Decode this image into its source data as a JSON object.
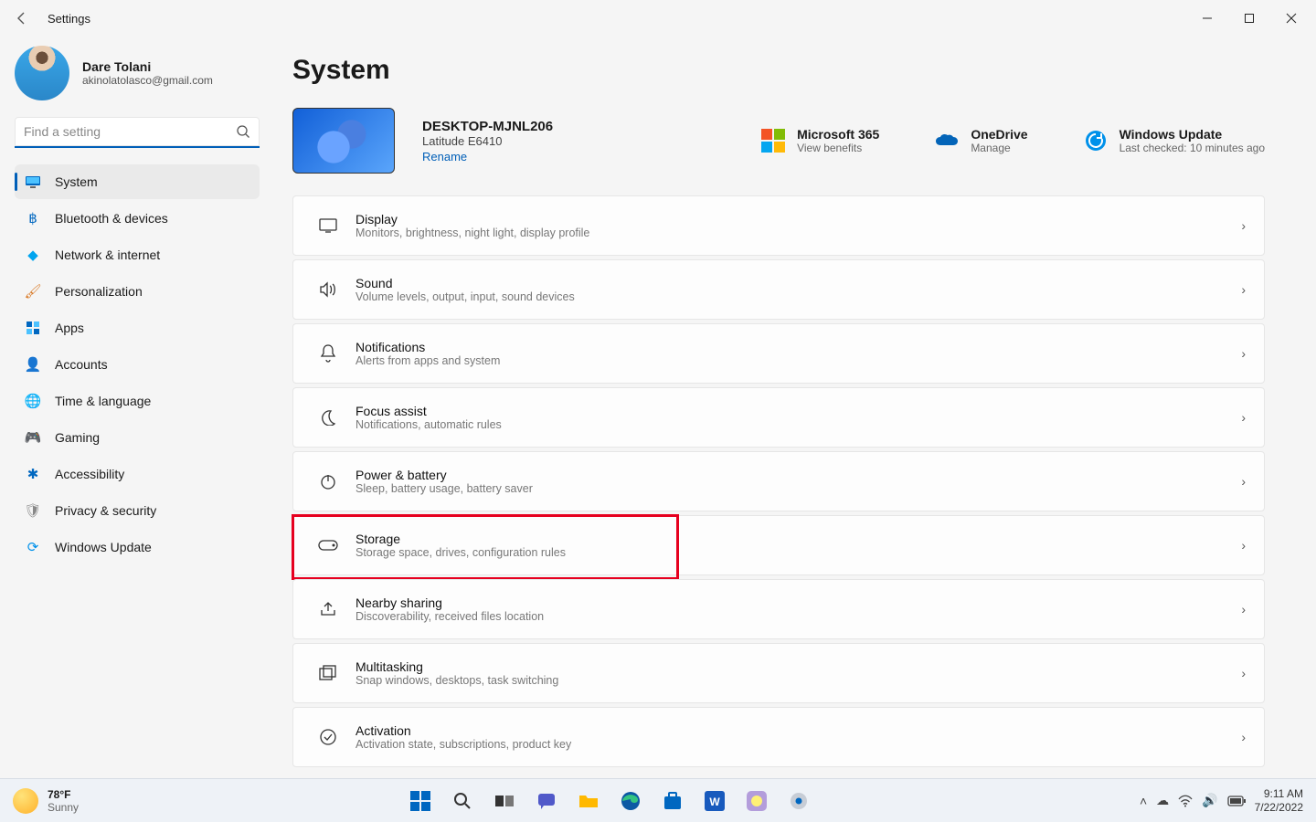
{
  "window": {
    "title": "Settings"
  },
  "user": {
    "name": "Dare Tolani",
    "email": "akinolatolasco@gmail.com"
  },
  "search": {
    "placeholder": "Find a setting"
  },
  "nav": [
    {
      "label": "System",
      "active": true,
      "icon": "monitor"
    },
    {
      "label": "Bluetooth & devices",
      "active": false,
      "icon": "bluetooth"
    },
    {
      "label": "Network & internet",
      "active": false,
      "icon": "wifi-gem"
    },
    {
      "label": "Personalization",
      "active": false,
      "icon": "brush"
    },
    {
      "label": "Apps",
      "active": false,
      "icon": "apps"
    },
    {
      "label": "Accounts",
      "active": false,
      "icon": "person"
    },
    {
      "label": "Time & language",
      "active": false,
      "icon": "globe-clock"
    },
    {
      "label": "Gaming",
      "active": false,
      "icon": "gamepad"
    },
    {
      "label": "Accessibility",
      "active": false,
      "icon": "accessibility"
    },
    {
      "label": "Privacy & security",
      "active": false,
      "icon": "shield"
    },
    {
      "label": "Windows Update",
      "active": false,
      "icon": "update"
    }
  ],
  "page_title": "System",
  "device": {
    "name": "DESKTOP-MJNL206",
    "model": "Latitude E6410",
    "rename": "Rename"
  },
  "services": {
    "ms365": {
      "title": "Microsoft 365",
      "sub": "View benefits"
    },
    "onedrive": {
      "title": "OneDrive",
      "sub": "Manage"
    },
    "update": {
      "title": "Windows Update",
      "sub": "Last checked: 10 minutes ago"
    }
  },
  "cards": {
    "display": {
      "title": "Display",
      "sub": "Monitors, brightness, night light, display profile"
    },
    "sound": {
      "title": "Sound",
      "sub": "Volume levels, output, input, sound devices"
    },
    "notifications": {
      "title": "Notifications",
      "sub": "Alerts from apps and system"
    },
    "focus": {
      "title": "Focus assist",
      "sub": "Notifications, automatic rules"
    },
    "power": {
      "title": "Power & battery",
      "sub": "Sleep, battery usage, battery saver"
    },
    "storage": {
      "title": "Storage",
      "sub": "Storage space, drives, configuration rules"
    },
    "nearby": {
      "title": "Nearby sharing",
      "sub": "Discoverability, received files location"
    },
    "multitask": {
      "title": "Multitasking",
      "sub": "Snap windows, desktops, task switching"
    },
    "activation": {
      "title": "Activation",
      "sub": "Activation state, subscriptions, product key"
    }
  },
  "taskbar": {
    "weather_temp": "78°F",
    "weather_label": "Sunny",
    "time": "9:11 AM",
    "date": "7/22/2022"
  }
}
